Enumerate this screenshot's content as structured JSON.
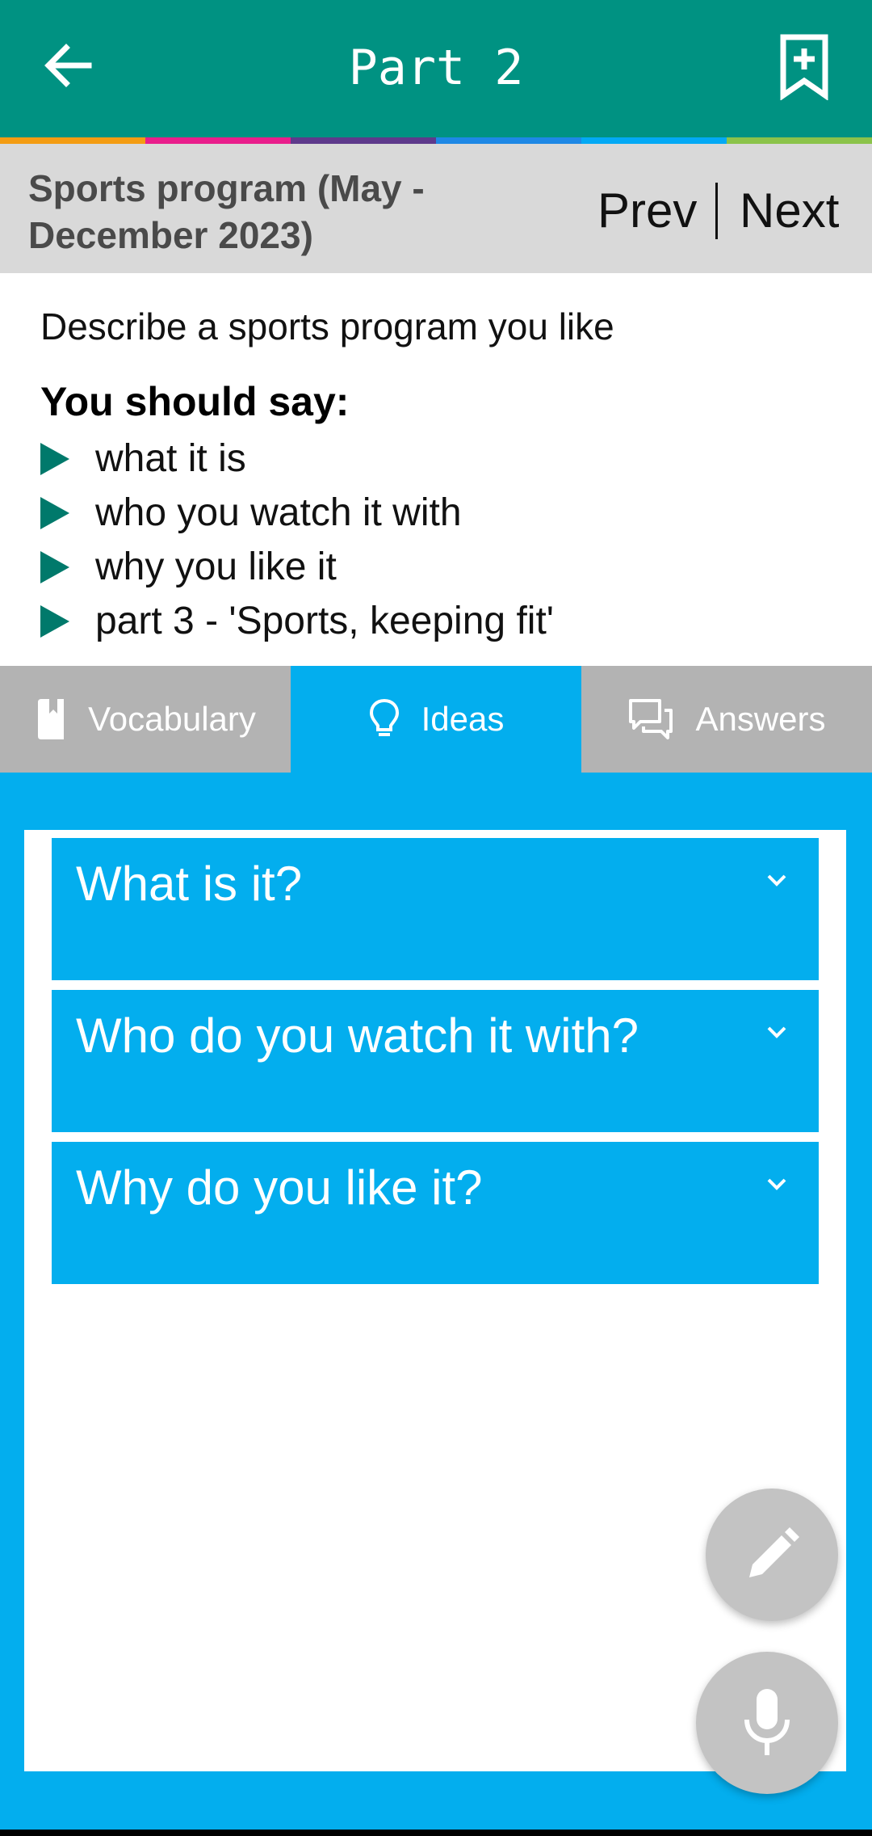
{
  "appbar": {
    "title": "Part 2",
    "back_icon": "arrow-left-icon",
    "bookmark_icon": "bookmark-add-icon"
  },
  "colors": {
    "primary": "#009282",
    "accent": "#03aeee",
    "strip": [
      "#f39c12",
      "#e91e8c",
      "#5e3a8c",
      "#1e88e5",
      "#03a9f4",
      "#8bc34a"
    ]
  },
  "nav": {
    "section_title": "Sports program (May - December 2023)",
    "prev": "Prev",
    "next": "Next"
  },
  "question": {
    "prompt": "Describe a sports program you like",
    "should_say": "You should say:",
    "bullets": [
      "what it is",
      "who you watch it with",
      "why you like it",
      "part 3 - 'Sports, keeping fit'"
    ]
  },
  "tabs": [
    {
      "label": "Vocabulary",
      "icon": "book-icon",
      "active": false
    },
    {
      "label": "Ideas",
      "icon": "lightbulb-icon",
      "active": true
    },
    {
      "label": "Answers",
      "icon": "chat-bubbles-icon",
      "active": false
    }
  ],
  "accordion": [
    "What is it?",
    "Who do you watch it with?",
    "Why do you like it?"
  ],
  "fabs": {
    "edit_icon": "pencil-icon",
    "mic_icon": "microphone-icon"
  }
}
